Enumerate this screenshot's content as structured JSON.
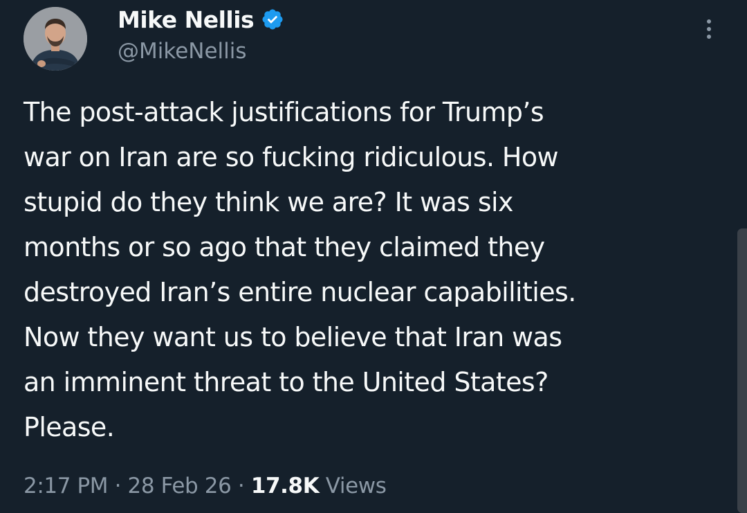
{
  "author": {
    "display_name": "Mike Nellis",
    "handle": "@MikeNellis",
    "verified_icon": "verified-badge-icon",
    "avatar_icon": "profile-photo"
  },
  "tweet": {
    "text": "The post-attack justifications for Trump’s\nwar on Iran are so fucking ridiculous. How\nstupid do they think we are? It was six\nmonths or so ago that they claimed they\ndestroyed Iran’s entire nuclear capabilities.\nNow they want us to believe that Iran was\nan imminent threat to the United States?\nPlease."
  },
  "meta": {
    "time": "2:17 PM",
    "separator": "·",
    "date": "28 Feb 26",
    "views_count": "17.8K",
    "views_label": "Views"
  },
  "colors": {
    "background": "#15202b",
    "text_primary": "#f7f9f9",
    "text_secondary": "#8b98a5",
    "verified": "#1d9bf0"
  }
}
